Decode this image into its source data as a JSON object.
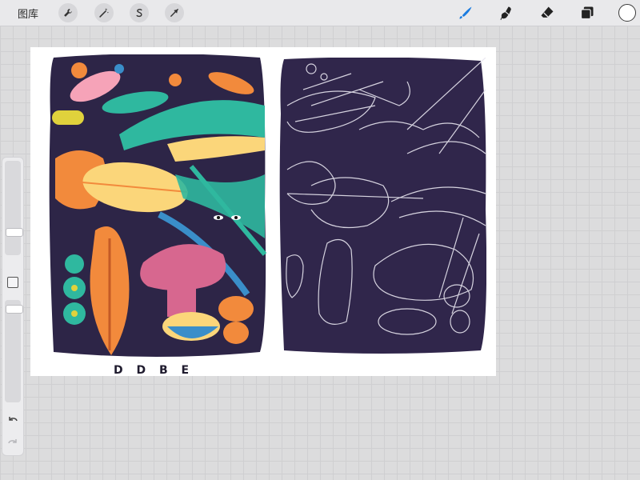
{
  "toolbar": {
    "gallery_label": "图库",
    "left_tools": [
      {
        "name": "actions",
        "icon": "wrench-icon"
      },
      {
        "name": "adjustments",
        "icon": "magic-wand-icon"
      },
      {
        "name": "selection",
        "icon": "selection-s-icon"
      },
      {
        "name": "transform",
        "icon": "arrow-cursor-icon"
      }
    ],
    "right_tools": [
      {
        "name": "brush",
        "icon": "brush-icon",
        "active": true
      },
      {
        "name": "smudge",
        "icon": "smudge-icon"
      },
      {
        "name": "eraser",
        "icon": "eraser-icon"
      },
      {
        "name": "layers",
        "icon": "layers-icon"
      },
      {
        "name": "color",
        "icon": "color-circle",
        "value": "#ffffff"
      }
    ]
  },
  "sidebar": {
    "brush_size_level": 0.3,
    "opacity_level": 0.95,
    "modify_button_icon": "square-icon",
    "undo_icon": "undo-icon",
    "redo_icon": "redo-icon"
  },
  "canvas": {
    "background": "#ffffff",
    "color_panel": {
      "background": "#2d2547",
      "accents": [
        "#f28a3c",
        "#f6a3b8",
        "#2fb89f",
        "#fbd67a",
        "#3a8ec9",
        "#e0d23c"
      ]
    },
    "sketch_panel": {
      "background": "#30264b",
      "stroke": "#e8e6f0"
    },
    "bottom_letters": "D D B E"
  },
  "colors": {
    "accent_blue": "#1a7be0",
    "toolbar_bg": "#e9e9eb",
    "canvas_grid_bg": "#dcdcdd"
  }
}
